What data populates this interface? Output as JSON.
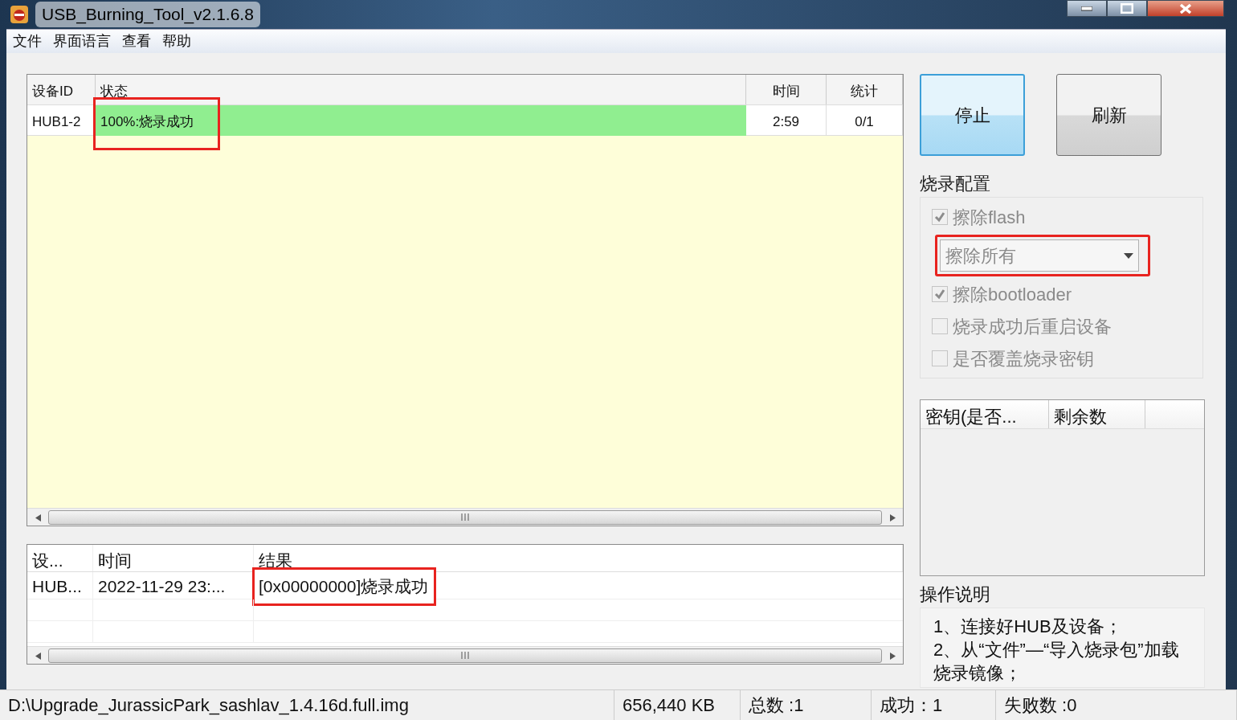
{
  "window": {
    "title": "USB_Burning_Tool_v2.1.6.8"
  },
  "menu": [
    "文件",
    "界面语言",
    "查看",
    "帮助"
  ],
  "device_table": {
    "columns": [
      "设备ID",
      "状态",
      "时间",
      "统计"
    ],
    "rows": [
      {
        "device_id": "HUB1-2",
        "status": "100%:烧录成功",
        "level": 1,
        "highlighted": true,
        "time": "2:59",
        "count": "0/1"
      }
    ]
  },
  "log_table": {
    "columns": [
      "设...",
      "时间",
      "结果"
    ],
    "rows": [
      {
        "device": "HUB...",
        "time": "2022-11-29 23:...",
        "result": "[0x00000000]烧录成功",
        "highlighted": true
      }
    ]
  },
  "buttons": [
    {
      "label": "停止",
      "kind": "primary"
    },
    {
      "label": "刷新",
      "kind": "normal"
    }
  ],
  "burn_config": {
    "title": "烧录配置",
    "options": [
      {
        "kind": "checkbox",
        "label": "擦除flash",
        "checked": true,
        "disabled": true
      },
      {
        "kind": "select",
        "value": "擦除所有",
        "disabled": true,
        "highlighted": true
      },
      {
        "kind": "checkbox",
        "label": "擦除bootloader",
        "checked": true,
        "disabled": true
      },
      {
        "kind": "checkbox",
        "label": "烧录成功后重启设备",
        "checked": false,
        "disabled": true
      },
      {
        "kind": "checkbox",
        "label": "是否覆盖烧录密钥",
        "checked": false,
        "disabled": true
      }
    ]
  },
  "key_table": {
    "columns": [
      "密钥(是否...",
      "剩余数"
    ]
  },
  "instructions": {
    "title": "操作说明",
    "lines": [
      "1、连接好HUB及设备；",
      "2、从“文件”—“导入烧录包”加载烧录镜像；"
    ]
  },
  "status_bar": [
    "D:\\Upgrade_JurassicPark_sashlav_1.4.16d.full.img",
    "656,440 KB",
    "总数 :1",
    "成功：1",
    "失败数 :0"
  ]
}
